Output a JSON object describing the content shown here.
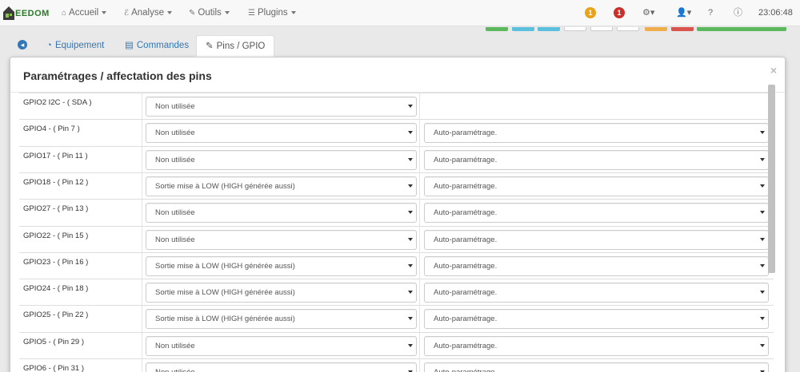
{
  "app": {
    "brand": "EEDOM"
  },
  "nav": {
    "menus": [
      {
        "label": "Accueil",
        "icon": "home-icon"
      },
      {
        "label": "Analyse",
        "icon": "stethoscope-icon"
      },
      {
        "label": "Outils",
        "icon": "wrench-icon"
      },
      {
        "label": "Plugins",
        "icon": "tasks-icon"
      }
    ],
    "badge_orange": "1",
    "badge_red": "1",
    "time": "23:06:48"
  },
  "tabs": [
    {
      "label": "Equipement",
      "icon": "tachometer-icon"
    },
    {
      "label": "Commandes",
      "icon": "list-alt-icon"
    },
    {
      "label": "Pins / GPIO",
      "icon": "wrench-icon"
    }
  ],
  "modal": {
    "title": "Paramétrages / affectation des pins",
    "close": "×"
  },
  "pins": [
    {
      "label": "GPIO2 I2C - ( SDA )",
      "mode": "Non utilisée",
      "param": ""
    },
    {
      "label": "GPIO4 - ( Pin 7 )",
      "mode": "Non utilisée",
      "param": "Auto-paramétrage."
    },
    {
      "label": "GPIO17 - ( Pin 11 )",
      "mode": "Non utilisée",
      "param": "Auto-paramétrage."
    },
    {
      "label": "GPIO18 - ( Pin 12 )",
      "mode": "Sortie mise à LOW (HIGH générée aussi)",
      "param": "Auto-paramétrage."
    },
    {
      "label": "GPIO27 - ( Pin 13 )",
      "mode": "Non utilisée",
      "param": "Auto-paramétrage."
    },
    {
      "label": "GPIO22 - ( Pin 15 )",
      "mode": "Non utilisée",
      "param": "Auto-paramétrage."
    },
    {
      "label": "GPIO23 - ( Pin 16 )",
      "mode": "Sortie mise à LOW (HIGH générée aussi)",
      "param": "Auto-paramétrage."
    },
    {
      "label": "GPIO24 - ( Pin 18 )",
      "mode": "Sortie mise à LOW (HIGH générée aussi)",
      "param": "Auto-paramétrage."
    },
    {
      "label": "GPIO25 - ( Pin 22 )",
      "mode": "Sortie mise à LOW (HIGH générée aussi)",
      "param": "Auto-paramétrage."
    },
    {
      "label": "GPIO5 - ( Pin 29 )",
      "mode": "Non utilisée",
      "param": "Auto-paramétrage."
    },
    {
      "label": "GPIO6 - ( Pin 31 )",
      "mode": "Non utilisée",
      "param": "Auto-paramétrage."
    }
  ],
  "colors": {
    "link": "#3577b4",
    "badge_orange": "#e8a317",
    "badge_red": "#c9302c",
    "btn_green": "#5cb85c",
    "btn_blue": "#5bc0de",
    "btn_orange": "#f0ad4e",
    "btn_red": "#d9534f"
  }
}
